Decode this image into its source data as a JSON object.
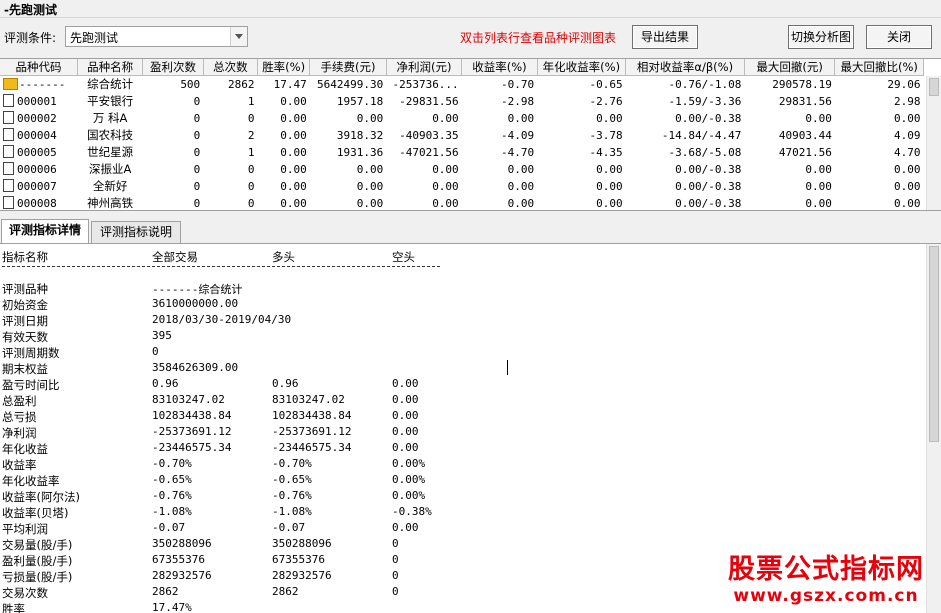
{
  "window": {
    "title": "-先跑测试"
  },
  "toolbar": {
    "cond_label": "评测条件:",
    "cond_value": "先跑测试",
    "hint": "双击列表行查看品种评测图表",
    "export_label": "导出结果",
    "switch_label": "切换分析图",
    "close_label": "关闭"
  },
  "grid": {
    "columns": [
      "品种代码",
      "品种名称",
      "盈利次数",
      "总次数",
      "胜率(%)",
      "手续费(元)",
      "净利润(元)",
      "收益率(%)",
      "年化收益率(%)",
      "相对收益率α/β(%)",
      "最大回撤(元)",
      "最大回撤比(%)"
    ],
    "rows": [
      [
        "-------",
        "综合统计",
        "500",
        "2862",
        "17.47",
        "5642499.30",
        "-253736...",
        "-0.70",
        "-0.65",
        "-0.76/-1.08",
        "290578.19",
        "29.06"
      ],
      [
        "000001",
        "平安银行",
        "0",
        "1",
        "0.00",
        "1957.18",
        "-29831.56",
        "-2.98",
        "-2.76",
        "-1.59/-3.36",
        "29831.56",
        "2.98"
      ],
      [
        "000002",
        "万 科A",
        "0",
        "0",
        "0.00",
        "0.00",
        "0.00",
        "0.00",
        "0.00",
        "0.00/-0.38",
        "0.00",
        "0.00"
      ],
      [
        "000004",
        "国农科技",
        "0",
        "2",
        "0.00",
        "3918.32",
        "-40903.35",
        "-4.09",
        "-3.78",
        "-14.84/-4.47",
        "40903.44",
        "4.09"
      ],
      [
        "000005",
        "世纪星源",
        "0",
        "1",
        "0.00",
        "1931.36",
        "-47021.56",
        "-4.70",
        "-4.35",
        "-3.68/-5.08",
        "47021.56",
        "4.70"
      ],
      [
        "000006",
        "深振业A",
        "0",
        "0",
        "0.00",
        "0.00",
        "0.00",
        "0.00",
        "0.00",
        "0.00/-0.38",
        "0.00",
        "0.00"
      ],
      [
        "000007",
        "全新好",
        "0",
        "0",
        "0.00",
        "0.00",
        "0.00",
        "0.00",
        "0.00",
        "0.00/-0.38",
        "0.00",
        "0.00"
      ],
      [
        "000008",
        "神州高铁",
        "0",
        "0",
        "0.00",
        "0.00",
        "0.00",
        "0.00",
        "0.00",
        "0.00/-0.38",
        "0.00",
        "0.00"
      ]
    ]
  },
  "tabs": [
    {
      "label": "评测指标详情",
      "active": true
    },
    {
      "label": "评测指标说明",
      "active": false
    }
  ],
  "detail": {
    "headers": [
      "指标名称",
      "全部交易",
      "多头",
      "空头"
    ],
    "rows": [
      [
        "评测品种",
        "-------综合统计",
        "",
        ""
      ],
      [
        "初始资金",
        "3610000000.00",
        "",
        ""
      ],
      [
        "评测日期",
        "2018/03/30-2019/04/30",
        "",
        ""
      ],
      [
        "有效天数",
        "395",
        "",
        ""
      ],
      [
        "评测周期数",
        "0",
        "",
        ""
      ],
      [
        "期末权益",
        "3584626309.00",
        "",
        ""
      ],
      [
        "盈亏时间比",
        "0.96",
        "0.96",
        "0.00"
      ],
      [
        "总盈利",
        "83103247.02",
        "83103247.02",
        "0.00"
      ],
      [
        "总亏损",
        "102834438.84",
        "102834438.84",
        "0.00"
      ],
      [
        "净利润",
        "-25373691.12",
        "-25373691.12",
        "0.00"
      ],
      [
        "年化收益",
        "-23446575.34",
        "-23446575.34",
        "0.00"
      ],
      [
        "收益率",
        "-0.70%",
        "-0.70%",
        "0.00%"
      ],
      [
        "年化收益率",
        "-0.65%",
        "-0.65%",
        "0.00%"
      ],
      [
        "收益率(阿尔法)",
        "-0.76%",
        "-0.76%",
        "0.00%"
      ],
      [
        "收益率(贝塔)",
        "-1.08%",
        "-1.08%",
        "-0.38%"
      ],
      [
        "平均利润",
        "-0.07",
        "-0.07",
        "0.00"
      ],
      [
        "交易量(股/手)",
        "350288096",
        "350288096",
        "0"
      ],
      [
        "盈利量(股/手)",
        "67355376",
        "67355376",
        "0"
      ],
      [
        "亏损量(股/手)",
        "282932576",
        "282932576",
        "0"
      ],
      [
        "交易次数",
        "2862",
        "2862",
        "0"
      ],
      [
        "胜率",
        "17.47%",
        "",
        ""
      ]
    ]
  },
  "watermark": {
    "line1": "股票公式指标网",
    "line2": "www.gszx.com.cn"
  }
}
